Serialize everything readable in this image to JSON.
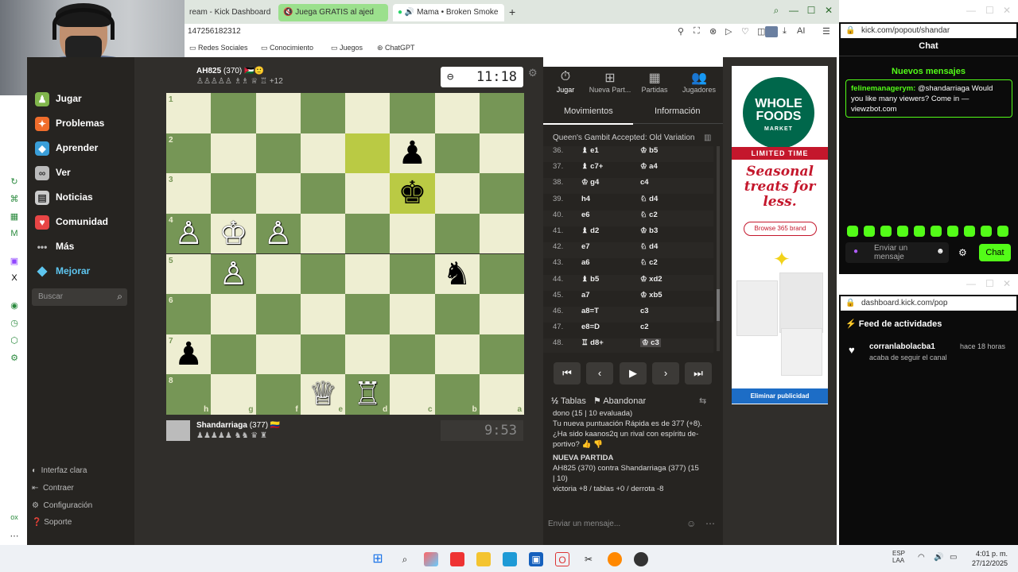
{
  "browser": {
    "tabs": [
      {
        "label": "ream - Kick Dashboard"
      },
      {
        "label": "Juega GRATIS al ajed"
      },
      {
        "label": "Mama • Broken Smoke"
      }
    ],
    "new_tab": "+",
    "address": "147256182312",
    "ai_label": "AI",
    "bookmarks": [
      "Redes Sociales",
      "Conocimiento",
      "Juegos",
      "ChatGPT"
    ]
  },
  "sidebar": {
    "items": [
      {
        "label": "Jugar",
        "icon": "pawn-icon",
        "color": "#81b64c"
      },
      {
        "label": "Problemas",
        "icon": "puzzle-icon",
        "color": "#f06d2c"
      },
      {
        "label": "Aprender",
        "icon": "learn-icon",
        "color": "#3a9ed8"
      },
      {
        "label": "Ver",
        "icon": "binoculars-icon",
        "color": "#bbbbbb"
      },
      {
        "label": "Noticias",
        "icon": "news-icon",
        "color": "#cccccc"
      },
      {
        "label": "Comunidad",
        "icon": "community-icon",
        "color": "#e84545"
      },
      {
        "label": "Más",
        "icon": "more-icon",
        "color": "#bbbbbb"
      },
      {
        "label": "Mejorar",
        "icon": "diamond-icon",
        "color": "#5ec6f0"
      }
    ],
    "search_placeholder": "Buscar",
    "bottom": [
      "Interfaz clara",
      "Contraer",
      "Configuración",
      "Soporte"
    ]
  },
  "game": {
    "opponent": {
      "name": "AH825",
      "rating": "(370)",
      "flags": "🇯🇴🙂",
      "material": "+12"
    },
    "self": {
      "name": "Shandarriaga",
      "rating": "(377)",
      "flag": "🇨🇴"
    },
    "clock_top": "11:18",
    "clock_bottom": "9:53",
    "ranks": [
      "1",
      "2",
      "3",
      "4",
      "5",
      "6",
      "7",
      "8"
    ],
    "files": [
      "h",
      "g",
      "f",
      "e",
      "d",
      "c",
      "b",
      "a"
    ],
    "highlight_colors": {
      "light": "#eeeed2",
      "dark": "#769656",
      "move": "#baca44"
    }
  },
  "panel": {
    "tabs": [
      {
        "label": "Jugar",
        "icon": "stopwatch-icon"
      },
      {
        "label": "Nueva Part...",
        "icon": "plus-icon"
      },
      {
        "label": "Partidas",
        "icon": "board-icon"
      },
      {
        "label": "Jugadores",
        "icon": "players-icon"
      }
    ],
    "subtabs": [
      "Movimientos",
      "Información"
    ],
    "opening": "Queen's Gambit Accepted: Old Variation",
    "moves": [
      {
        "n": "36.",
        "w": "♝ e1",
        "b": "♔ b5"
      },
      {
        "n": "37.",
        "w": "♝ c7+",
        "b": "♔ a4"
      },
      {
        "n": "38.",
        "w": "♔ g4",
        "b": "c4"
      },
      {
        "n": "39.",
        "w": "h4",
        "b": "♘ d4"
      },
      {
        "n": "40.",
        "w": "e6",
        "b": "♘ c2"
      },
      {
        "n": "41.",
        "w": "♝ d2",
        "b": "♔ b3"
      },
      {
        "n": "42.",
        "w": "e7",
        "b": "♘ d4"
      },
      {
        "n": "43.",
        "w": "a6",
        "b": "♘ c2"
      },
      {
        "n": "44.",
        "w": "♝ b5",
        "b": "♔ xd2"
      },
      {
        "n": "45.",
        "w": "a7",
        "b": "♔ xb5"
      },
      {
        "n": "46.",
        "w": "a8=T",
        "b": "c3"
      },
      {
        "n": "47.",
        "w": "e8=D",
        "b": "c2"
      },
      {
        "n": "48.",
        "w": "♖ d8+",
        "b": "♔ c3"
      }
    ],
    "actions": {
      "draw": "Tablas",
      "resign": "Abandonar",
      "half": "½"
    },
    "chat": [
      "dono (15 | 10 evaluada)",
      "Tu nueva puntuación Rápida es de 377 (+8).",
      "¿Ha sido kaanos2q un rival con espíritu de-",
      "portivo?",
      "NUEVA PARTIDA",
      "AH825 (370) contra Shandarriaga (377) (15",
      "| 10)",
      "victoria +8 / tablas +0 / derrota -8"
    ],
    "chat_placeholder": "Enviar un mensaje..."
  },
  "ad": {
    "brand_line1": "WHOLE",
    "brand_line2": "FOODS",
    "brand_line3": "MARKET",
    "limited": "LIMITED TIME",
    "headline": "Seasonal treats for less.",
    "button": "Browse 365 brand",
    "remove": "Eliminar publicidad"
  },
  "kick_chat": {
    "address": "kick.com/popout/shandar",
    "title": "Chat",
    "new_messages": "Nuevos mensajes",
    "message_user": "felinemanagerym:",
    "message_text": "@shandarriaga Would you like many viewers? Come in — viewzbot.com",
    "input_placeholder": "Enviar un mensaje",
    "chat_button": "Chat"
  },
  "kick_dashboard": {
    "address": "dashboard.kick.com/pop",
    "feed_title": "Feed de actividades",
    "follower": "corranlabolacba1",
    "follow_text": "acaba de seguir el canal",
    "time_ago": "hace 18 horas"
  },
  "taskbar": {
    "lang1": "ESP",
    "lang2": "LAA",
    "time": "4:01 p. m.",
    "date": "27/12/2025"
  }
}
